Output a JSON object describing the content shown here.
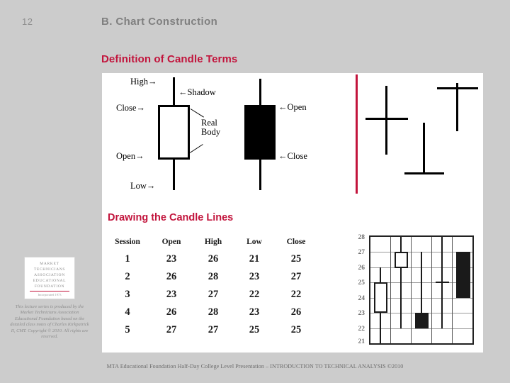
{
  "slide": {
    "number": "12",
    "title": "B.  Chart Construction",
    "section_heading": "Definition of Candle Terms",
    "drawing_heading": "Drawing the Candle Lines",
    "accent_color": "#C2143C",
    "title_color": "#808080",
    "background_color": "#CCCCCC",
    "panel_color": "#FFFFFF"
  },
  "figure": {
    "labels": {
      "high": "High",
      "close": "Close",
      "open": "Open",
      "low": "Low",
      "shadow": "Shadow",
      "real_body_line1": "Real",
      "real_body_line2": "Body",
      "black_open": "Open",
      "black_close": "Close"
    },
    "arrows": {
      "right_arrow": "→",
      "left_arrow": "←"
    }
  },
  "table": {
    "columns": [
      "Session",
      "Open",
      "High",
      "Low",
      "Close"
    ],
    "rows": [
      {
        "session": "1",
        "open": "23",
        "high": "26",
        "low": "21",
        "close": "25"
      },
      {
        "session": "2",
        "open": "26",
        "high": "28",
        "low": "23",
        "close": "27"
      },
      {
        "session": "3",
        "open": "23",
        "high": "27",
        "low": "22",
        "close": "22"
      },
      {
        "session": "4",
        "open": "26",
        "high": "28",
        "low": "23",
        "close": "26"
      },
      {
        "session": "5",
        "open": "27",
        "high": "27",
        "low": "25",
        "close": "25"
      }
    ]
  },
  "chart_data": {
    "type": "candlestick",
    "title": "",
    "xlabel": "",
    "ylabel": "",
    "ylim": [
      21,
      28
    ],
    "yticks": [
      "28",
      "27",
      "26",
      "25",
      "24",
      "23",
      "22",
      "21"
    ],
    "grid": true,
    "legend": "none",
    "categories": [
      "1",
      "2",
      "3",
      "4",
      "5"
    ],
    "series": [
      {
        "name": "Session 1",
        "open": 23,
        "high": 26,
        "low": 21,
        "close": 25,
        "direction": "up",
        "body": "hollow"
      },
      {
        "name": "Session 2",
        "open": 26,
        "high": 28,
        "low": 23,
        "close": 27,
        "direction": "up",
        "body": "hollow"
      },
      {
        "name": "Session 3",
        "open": 23,
        "high": 27,
        "low": 22,
        "close": 22,
        "direction": "down",
        "body": "filled"
      },
      {
        "name": "Session 4",
        "open": 26,
        "high": 28,
        "low": 23,
        "close": 26,
        "direction": "flat",
        "body": "doji"
      },
      {
        "name": "Session 5",
        "open": 27,
        "high": 27,
        "low": 25,
        "close": 25,
        "direction": "down",
        "body": "filled"
      }
    ]
  },
  "logo": {
    "line1": "MARKET",
    "line2": "TECHNICIANS",
    "line3": "ASSOCIATION",
    "line4": "EDUCATIONAL",
    "line5": "FOUNDATION",
    "tagline": "Incorporated 1973"
  },
  "credits": {
    "text": "This lecture series is produced by the Market Technicians Association Educational Foundation based on the detailed class notes of Charles Kirkpatrick II, CMT. Copyright © 2010. All rights are reserved."
  },
  "footer": {
    "text": "MTA Educational Foundation Half-Day College Level Presentation – INTRODUCTION TO TECHNICAL ANALYSIS ©2010"
  }
}
